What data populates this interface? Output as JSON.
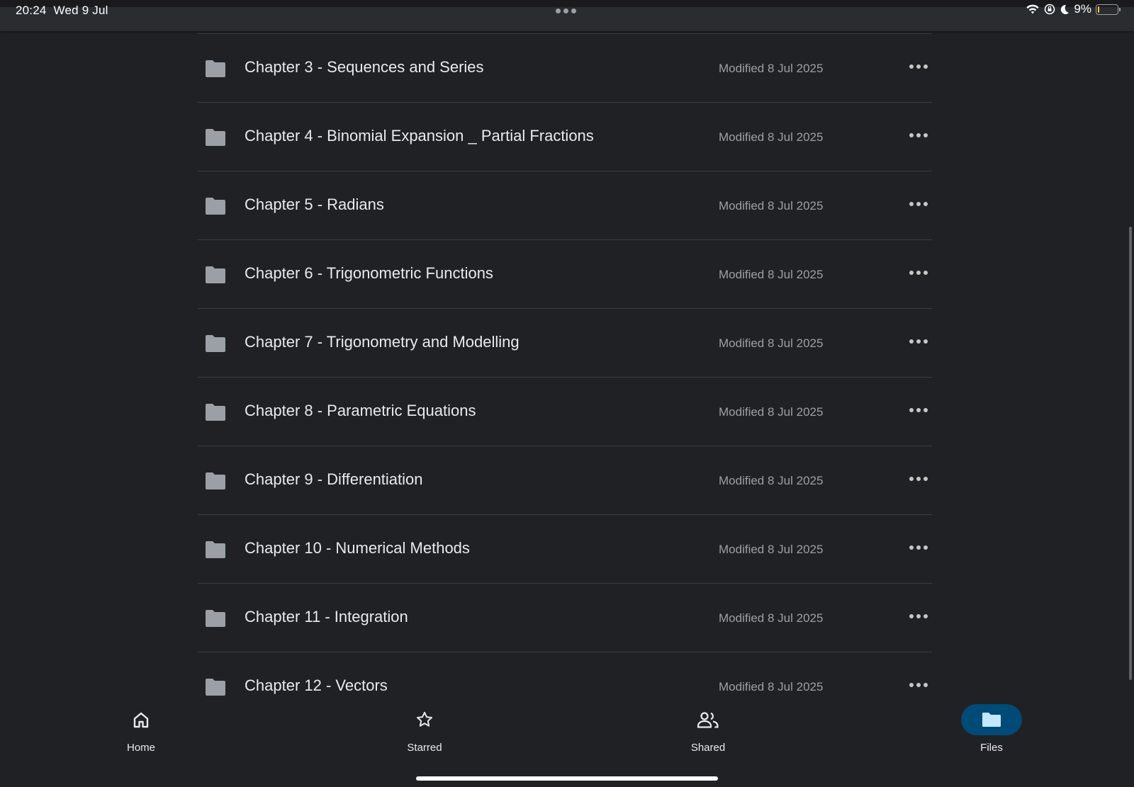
{
  "status_bar": {
    "time": "20:24",
    "date": "Wed 9 Jul",
    "battery_percent": "9%",
    "battery_level": 0.09,
    "icons": [
      "wifi-icon",
      "screen-lock-icon",
      "do-not-disturb-icon",
      "battery-icon"
    ]
  },
  "files": [
    {
      "name": "Chapter 3 - Sequences and Series",
      "modified": "Modified 8 Jul 2025"
    },
    {
      "name": "Chapter 4 - Binomial Expansion _ Partial Fractions",
      "modified": "Modified 8 Jul 2025"
    },
    {
      "name": "Chapter 5 - Radians",
      "modified": "Modified 8 Jul 2025"
    },
    {
      "name": "Chapter 6 - Trigonometric Functions",
      "modified": "Modified 8 Jul 2025"
    },
    {
      "name": "Chapter 7 - Trigonometry and Modelling",
      "modified": "Modified 8 Jul 2025"
    },
    {
      "name": "Chapter 8 - Parametric Equations",
      "modified": "Modified 8 Jul 2025"
    },
    {
      "name": "Chapter 9 - Differentiation",
      "modified": "Modified 8 Jul 2025"
    },
    {
      "name": "Chapter 10 - Numerical Methods",
      "modified": "Modified 8 Jul 2025"
    },
    {
      "name": "Chapter 11 - Integration",
      "modified": "Modified 8 Jul 2025"
    },
    {
      "name": "Chapter 12 - Vectors",
      "modified": "Modified 8 Jul 2025"
    }
  ],
  "bottom_nav": {
    "home": "Home",
    "starred": "Starred",
    "shared": "Shared",
    "files": "Files",
    "active": "files"
  },
  "colors": {
    "background": "#202124",
    "active_nav": "#004a77",
    "folder": "#9aa0a6",
    "active_icon": "#c2e7ff"
  }
}
